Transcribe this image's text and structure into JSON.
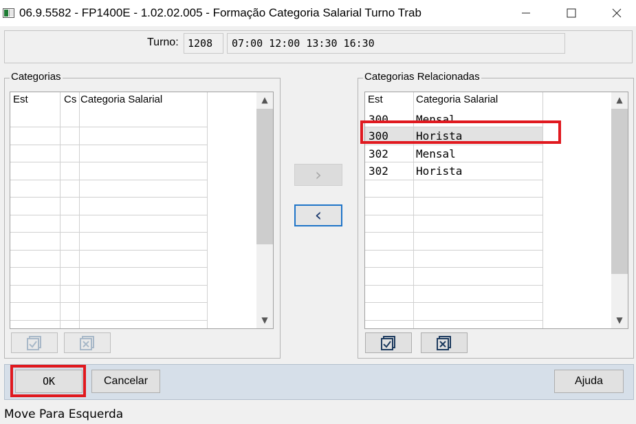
{
  "window": {
    "title": "06.9.5582 - FP1400E - 1.02.02.005 - Formação Categoria Salarial Turno Trab",
    "minimize_icon": "minimize-icon",
    "maximize_icon": "maximize-icon",
    "close_icon": "close-icon"
  },
  "turno": {
    "label": "Turno:",
    "code": "1208",
    "times": "07:00 12:00 13:30 16:30"
  },
  "categorias": {
    "title": "Categorias",
    "columns": [
      "Est",
      "Cs",
      "Categoria Salarial"
    ],
    "rows": []
  },
  "relacionadas": {
    "title": "Categorias Relacionadas",
    "columns": [
      "Est",
      "Categoria Salarial"
    ],
    "rows": [
      {
        "est": "300",
        "categoria": "Mensal"
      },
      {
        "est": "300",
        "categoria": "Horista"
      },
      {
        "est": "302",
        "categoria": "Mensal"
      },
      {
        "est": "302",
        "categoria": "Horista"
      }
    ],
    "selected_row": 1
  },
  "move_buttons": {
    "right_glyph": "›",
    "left_glyph": "‹"
  },
  "buttons": {
    "ok": "OK",
    "cancel": "Cancelar",
    "help": "Ajuda"
  },
  "status": "Move Para Esquerda",
  "colors": {
    "highlight": "#e0191f",
    "focus_border": "#1e74c8",
    "bottom_bar": "#d6dfe9"
  }
}
